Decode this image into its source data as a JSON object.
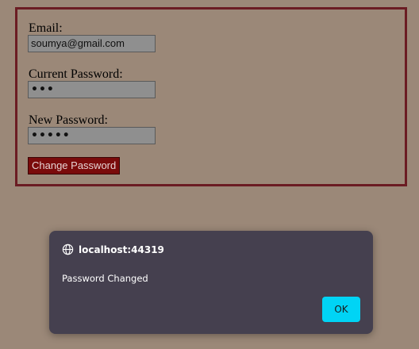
{
  "form": {
    "email_label": "Email:",
    "email_value": "soumya@gmail.com",
    "current_password_label": "Current Password:",
    "current_password_value": "•••",
    "new_password_label": "New Password:",
    "new_password_value": "•••••",
    "submit_label": "Change Password"
  },
  "dialog": {
    "origin": "localhost:44319",
    "origin_icon": "globe-icon",
    "message": "Password Changed",
    "ok_label": "OK"
  },
  "colors": {
    "page_background": "#9b8878",
    "form_border": "#6b1c23",
    "submit_button": "#7a0b0b",
    "dialog_background": "#45404f",
    "ok_button": "#00d4f5"
  }
}
